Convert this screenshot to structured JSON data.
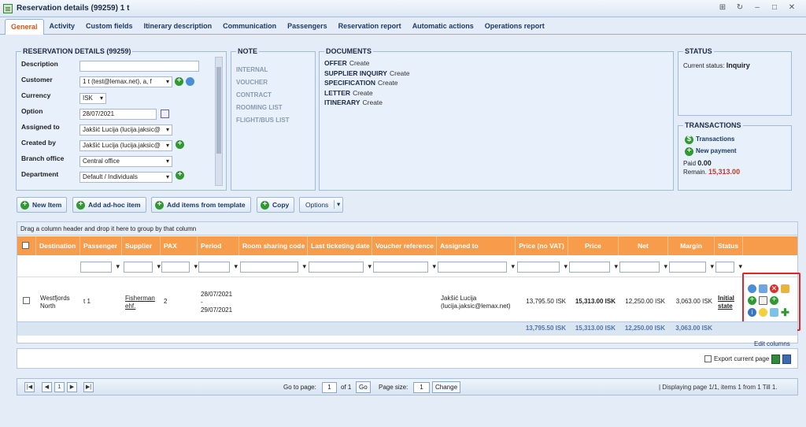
{
  "window": {
    "title": "Reservation details (99259) 1 t"
  },
  "tabs": [
    "General",
    "Activity",
    "Custom fields",
    "Itinerary description",
    "Communication",
    "Passengers",
    "Reservation report",
    "Automatic actions",
    "Operations report"
  ],
  "details": {
    "legend": "RESERVATION DETAILS (99259)",
    "labels": {
      "description": "Description",
      "customer": "Customer",
      "currency": "Currency",
      "option": "Option",
      "assigned_to": "Assigned to",
      "created_by": "Created by",
      "branch_office": "Branch office",
      "department": "Department"
    },
    "values": {
      "description": "",
      "customer": "1 t (test@lemax.net), a, f",
      "currency": "ISK",
      "option": "28/07/2021",
      "assigned_to": "Jakšić Lucija (lucija.jaksic@",
      "created_by": "Jakšić Lucija (lucija.jaksic@",
      "branch_office": "Central office",
      "department": "Default / Individuals"
    }
  },
  "note": {
    "legend": "NOTE",
    "items": [
      "INTERNAL",
      "VOUCHER",
      "CONTRACT",
      "ROOMING LIST",
      "FLIGHT/BUS LIST"
    ]
  },
  "documents": {
    "legend": "DOCUMENTS",
    "items": [
      {
        "name": "OFFER",
        "action": "Create"
      },
      {
        "name": "SUPPLIER INQUIRY",
        "action": "Create"
      },
      {
        "name": "SPECIFICATION",
        "action": "Create"
      },
      {
        "name": "LETTER",
        "action": "Create"
      },
      {
        "name": "ITINERARY",
        "action": "Create"
      }
    ]
  },
  "status": {
    "legend": "STATUS",
    "label": "Current status:",
    "value": "Inquiry"
  },
  "transactions": {
    "legend": "TRANSACTIONS",
    "transactions_link": "Transactions",
    "new_payment_link": "New payment",
    "paid_label": "Paid",
    "paid_value": "0.00",
    "remain_label": "Remain.",
    "remain_value": "15,313.00"
  },
  "toolbar": {
    "new_item": "New Item",
    "add_adhoc": "Add ad-hoc item",
    "add_template": "Add items from template",
    "copy": "Copy",
    "options": "Options"
  },
  "grid": {
    "group_hint": "Drag a column header and drop it here to group by that column",
    "headers": [
      "Destination",
      "Passenger",
      "Supplier",
      "PAX",
      "Period",
      "Room sharing code",
      "Last ticketing date",
      "Voucher reference",
      "Assigned to",
      "Price (no VAT)",
      "Price",
      "Net",
      "Margin",
      "Status"
    ],
    "row": {
      "destination": "Westfjords North",
      "passenger": "t 1",
      "supplier": "Fisherman ehf.",
      "pax": "2",
      "period_start": "28/07/2021",
      "period_sep": "-",
      "period_end": "29/07/2021",
      "assigned_to": "Jakšić Lucija (lucija.jaksic@lemax.net)",
      "price_no_vat": "13,795.50 ISK",
      "price": "15,313.00 ISK",
      "net": "12,250.00 ISK",
      "margin": "3,063.00 ISK",
      "status": "Initial state"
    },
    "totals": {
      "price_no_vat": "13,795.50 ISK",
      "price": "15,313.00 ISK",
      "net": "12,250.00 ISK",
      "margin": "3,063.00 ISK"
    },
    "edit_columns": "Edit columns",
    "export_label": "Export current page"
  },
  "pager": {
    "go_to_page": "Go to page:",
    "page_value": "1",
    "of_label": "of 1",
    "go_button": "Go",
    "page_size_label": "Page size:",
    "page_size_value": "1",
    "change_button": "Change",
    "first_page": "1",
    "summary": "| Displaying page 1/1, items 1 from 1 Till 1."
  },
  "colors": {
    "accent_orange": "#f79c4a",
    "remain_red": "#c0392b",
    "highlight_red": "#e0262b"
  }
}
